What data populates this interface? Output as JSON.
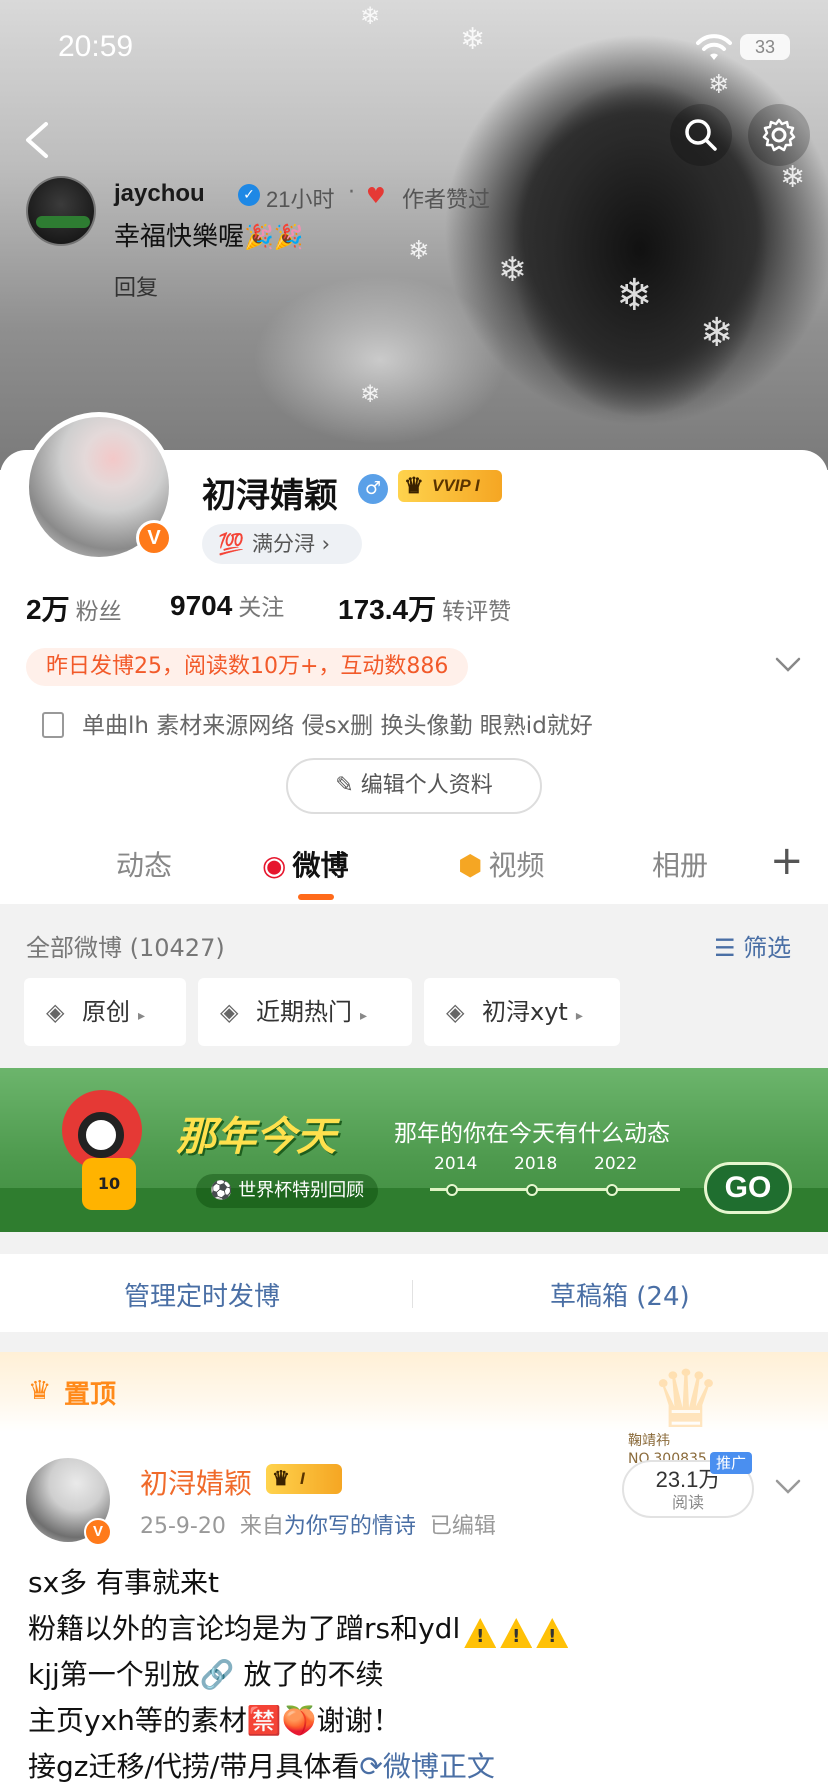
{
  "status": {
    "time": "20:59",
    "battery": "33"
  },
  "nav": {},
  "comment": {
    "name": "jaychou",
    "ago": "21小时",
    "separator": "·",
    "liked": "作者赞过",
    "text": "幸福快樂喔",
    "emoji": "🎉🎉",
    "reply": "回复"
  },
  "profile": {
    "name": "初浔婧颖",
    "gender": "♂",
    "vip": "VVIP I",
    "v_badge": "V",
    "medal": "满分浔 ›",
    "stats": [
      {
        "value": "2万",
        "label": "粉丝"
      },
      {
        "value": "9704",
        "label": "关注"
      },
      {
        "value": "173.4万",
        "label": "转评赞"
      }
    ],
    "yesterday": "昨日发博25，阅读数10万+，互动数886",
    "bio": "单曲lh 素材来源网络 侵sx删 换头像勤 眼熟id就好",
    "edit": "编辑个人资料"
  },
  "tabs": [
    {
      "label": "动态",
      "icon": ""
    },
    {
      "label": "微博",
      "icon": "weibo-icon"
    },
    {
      "label": "视频",
      "icon": "video-icon"
    },
    {
      "label": "相册",
      "icon": ""
    }
  ],
  "tab_plus": "+",
  "posts_header": {
    "all": "全部微博 (10427)",
    "filter": "筛选"
  },
  "chips": [
    "原创",
    "近期热门",
    "初浔xyt"
  ],
  "banner": {
    "title": "那年今天",
    "subtitle": "那年的你在今天有什么动态",
    "worldcup": "⚽ 世界杯特别回顾",
    "years": [
      "2014",
      "2018",
      "2022"
    ],
    "go": "GO",
    "jersey": "10"
  },
  "manage": {
    "scheduled": "管理定时发博",
    "drafts": "草稿箱 (24)"
  },
  "pinned": {
    "label": "置顶",
    "author": "初浔婧颖",
    "badge": "I",
    "v_badge": "V",
    "date": "25-9-20",
    "from_label": "来自",
    "source": "为你写的情诗",
    "edited": "已编辑",
    "fan_tag": "鞠靖祎",
    "fan_no": "NO.300835",
    "promo": "推广",
    "reads_value": "23.1万",
    "reads_label": "阅读",
    "lines": [
      "sx多 有事就来t",
      "粉籍以外的言论均是为了蹭rs和ydl",
      "kjj第一个别放🔗 放了的不续",
      "主页yxh等的素材🈲🍑谢谢！",
      "接gz迁移/代捞/带月具体看"
    ],
    "full_text": "微博正文"
  },
  "colors": {
    "accent": "#ff6a1a",
    "link": "#4a6fa5",
    "vip": "#f5a623"
  }
}
